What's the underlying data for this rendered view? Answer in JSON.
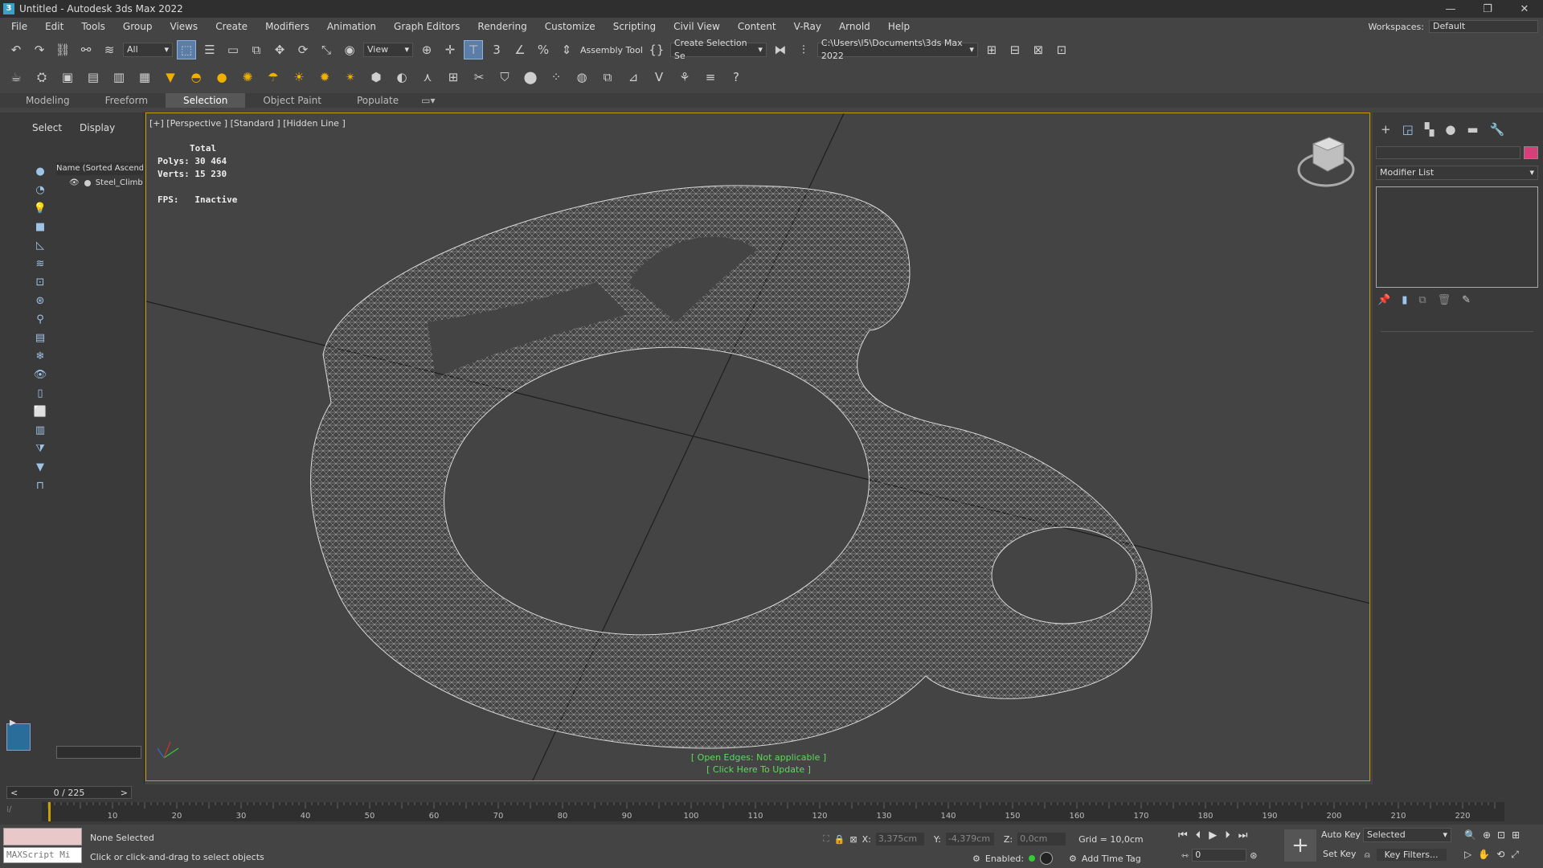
{
  "window": {
    "title": "Untitled - Autodesk 3ds Max 2022",
    "app_badge": "3"
  },
  "menu": [
    "File",
    "Edit",
    "Tools",
    "Group",
    "Views",
    "Create",
    "Modifiers",
    "Animation",
    "Graph Editors",
    "Rendering",
    "Customize",
    "Scripting",
    "Civil View",
    "Content",
    "V-Ray",
    "Arnold",
    "Help"
  ],
  "workspace": {
    "label": "Workspaces:",
    "value": "Default"
  },
  "toolbar1": {
    "filter": "All",
    "view": "View",
    "assembly": "Assembly Tool",
    "selection_set": "Create Selection Se",
    "path": "C:\\Users\\l5\\Documents\\3ds Max 2022"
  },
  "ribbon_tabs": [
    "Modeling",
    "Freeform",
    "Selection",
    "Object Paint",
    "Populate"
  ],
  "scene": {
    "tab_select": "Select",
    "tab_display": "Display",
    "column_header": "Name (Sorted Ascend",
    "object": "Steel_Climb"
  },
  "viewport": {
    "label": "[+] [Perspective ] [Standard ] [Hidden Line ]",
    "stats_total": "Total",
    "polys_label": "Polys:",
    "polys": "30 464",
    "verts_label": "Verts:",
    "verts": "15 230",
    "fps_label": "FPS:",
    "fps": "Inactive",
    "open_edges": "[ Open Edges: Not applicable ]",
    "click_update": "[ Click Here To Update ]"
  },
  "command_panel": {
    "modifier_list": "Modifier List",
    "color_swatch": "#d6407a"
  },
  "timeline": {
    "frame": "0 / 225",
    "ticks": [
      "10",
      "20",
      "30",
      "40",
      "50",
      "60",
      "70",
      "80",
      "90",
      "100",
      "110",
      "120",
      "130",
      "140",
      "150",
      "160",
      "170",
      "180",
      "190",
      "200",
      "210",
      "220"
    ]
  },
  "status": {
    "selection": "None Selected",
    "hint": "Click or click-and-drag to select objects",
    "maxscript": "MAXScript Mi",
    "x_label": "X:",
    "x": "3,375cm",
    "y_label": "Y:",
    "y": "-4,379cm",
    "z_label": "Z:",
    "z": "0,0cm",
    "grid": "Grid = 10,0cm",
    "enabled": "Enabled:",
    "add_time_tag": "Add Time Tag",
    "auto_key": "Auto Key",
    "set_key": "Set Key",
    "selected": "Selected",
    "key_filters": "Key Filters...",
    "current_frame": "0"
  }
}
